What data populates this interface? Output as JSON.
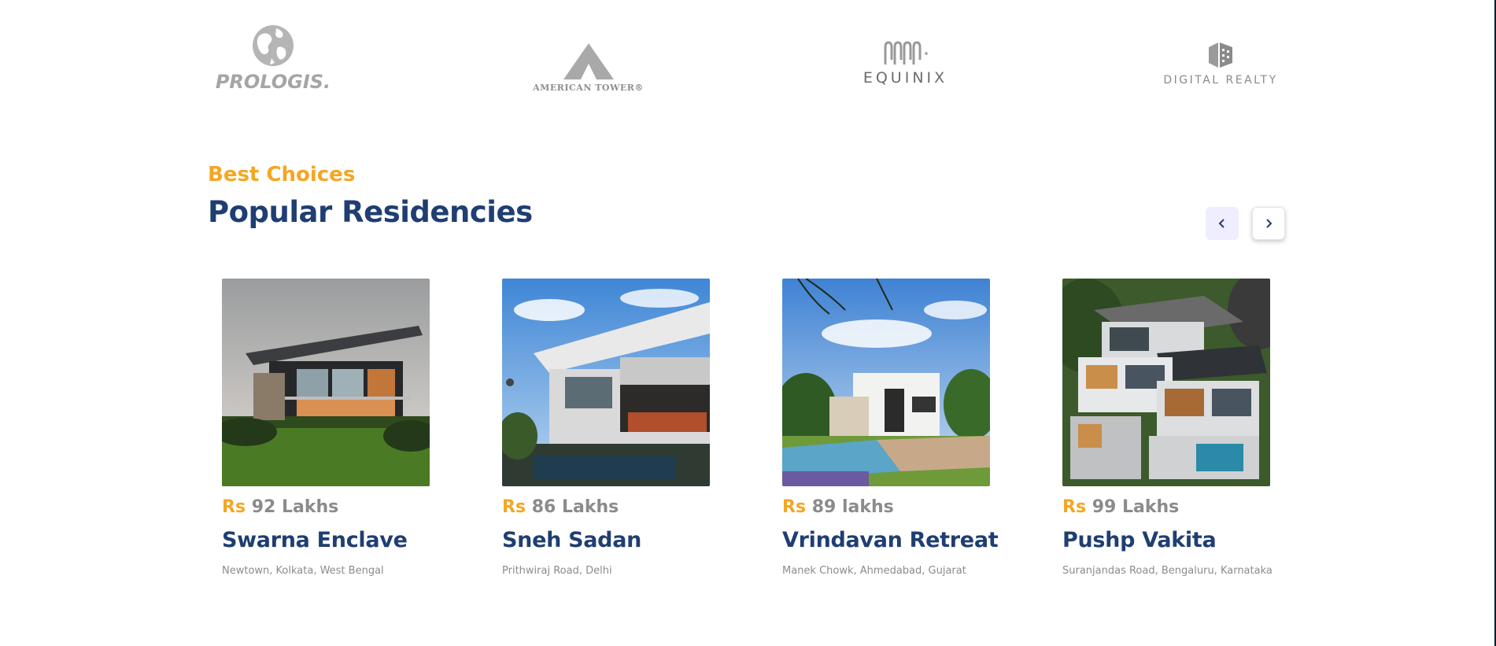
{
  "partners": {
    "logos": [
      {
        "name": "PROLOGIS.",
        "icon": "globe-icon"
      },
      {
        "name": "AMERICAN TOWER®",
        "icon": "tower-triangle-icon"
      },
      {
        "name": "EQUINIX",
        "icon": "equinix-bars-icon"
      },
      {
        "name": "DIGITAL REALTY",
        "icon": "cube-icon"
      }
    ]
  },
  "section": {
    "subtitle": "Best Choices",
    "title": "Popular Residencies"
  },
  "slider": {
    "prev_icon": "chevron-left-icon",
    "next_icon": "chevron-right-icon"
  },
  "colors": {
    "accent": "#f5a623",
    "primary": "#1f3e72",
    "muted": "#8c8b8b",
    "button_bg": "#eeeeff"
  },
  "residencies": [
    {
      "currency": "Rs",
      "price": " 92 Lakhs",
      "name": "Swarna Enclave",
      "address": "Newtown, Kolkata, West Bengal"
    },
    {
      "currency": "Rs",
      "price": " 86 Lakhs",
      "name": "Sneh Sadan",
      "address": "Prithwiraj Road, Delhi"
    },
    {
      "currency": "Rs",
      "price": " 89 lakhs",
      "name": "Vrindavan Retreat",
      "address": "Manek Chowk, Ahmedabad, Gujarat"
    },
    {
      "currency": "Rs",
      "price": " 99 Lakhs",
      "name": "Pushp Vakita",
      "address": "Suranjandas Road, Bengaluru, Karnataka"
    }
  ]
}
